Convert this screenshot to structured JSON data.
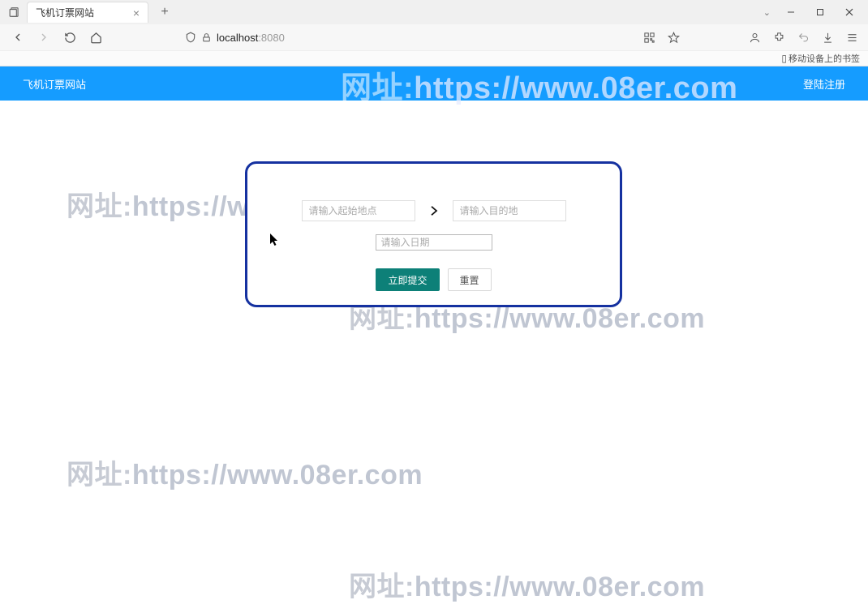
{
  "browser": {
    "tab_title": "飞机订票网站",
    "url_host": "localhost",
    "url_port": ":8080",
    "bookmark_label": "移动设备上的书签"
  },
  "banner": {
    "title": "飞机订票网站",
    "login": "登陆注册"
  },
  "watermark": {
    "prefix": "网址:",
    "url": "https://www.08er.com"
  },
  "form": {
    "origin_placeholder": "请输入起始地点",
    "destination_placeholder": "请输入目的地",
    "date_placeholder": "请输入日期",
    "submit_label": "立即提交",
    "reset_label": "重置"
  }
}
